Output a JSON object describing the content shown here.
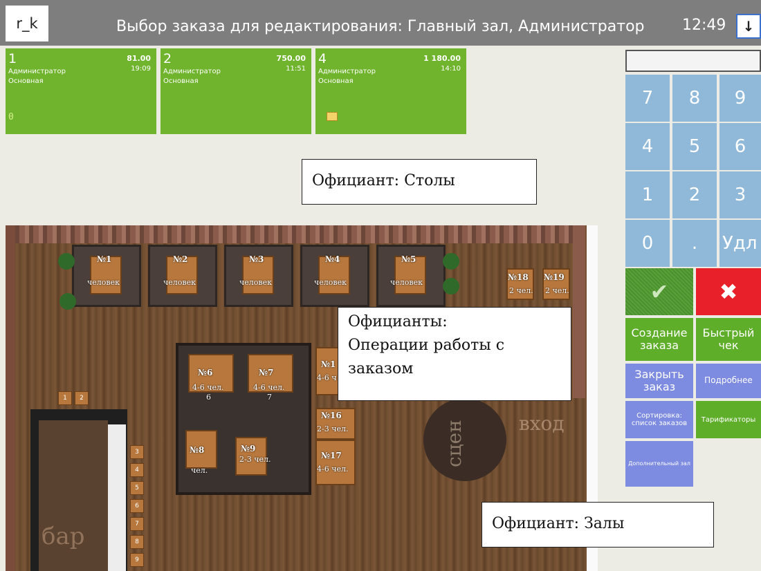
{
  "header": {
    "logo": "r_k",
    "title": "Выбор заказа для редактирования: Главный зал, Администратор",
    "time": "12:49",
    "download_glyph": "↓"
  },
  "orders": [
    {
      "number": "1",
      "sum": "81.00",
      "user": "Администратор",
      "time": "19:09",
      "hall": "Основная",
      "counter": "0",
      "icon": ""
    },
    {
      "number": "2",
      "sum": "750.00",
      "user": "Администратор",
      "time": "11:51",
      "hall": "Основная",
      "counter": "",
      "icon": ""
    },
    {
      "number": "4",
      "sum": "1 180.00",
      "user": "Администратор",
      "time": "14:10",
      "hall": "Основная",
      "counter": "",
      "icon": "folder-icon"
    }
  ],
  "notes": {
    "tables": "Официант: Столы",
    "operations_line1": "Официанты:",
    "operations_line2": "Операции работы с",
    "operations_line3": "заказом",
    "halls": "Официант: Залы"
  },
  "floor": {
    "tables": [
      {
        "id": "№1",
        "cap": "человек"
      },
      {
        "id": "№2",
        "cap": "человек"
      },
      {
        "id": "№3",
        "cap": "человек"
      },
      {
        "id": "№4",
        "cap": "человек"
      },
      {
        "id": "№5",
        "cap": "человек"
      },
      {
        "id": "№18",
        "cap": "2 чел."
      },
      {
        "id": "№19",
        "cap": "2 чел."
      },
      {
        "id": "№6",
        "cap": "4-6 чел."
      },
      {
        "id": "№7",
        "cap": "4-6 чел."
      },
      {
        "id": "№1",
        "cap": "4-6 ч"
      },
      {
        "id": "№16",
        "cap": "2-3 чел."
      },
      {
        "id": "№17",
        "cap": "4-6 чел."
      },
      {
        "id": "№8",
        "cap": "чел."
      },
      {
        "id": "№9",
        "cap": "2-3 чел."
      }
    ],
    "bar_seats": [
      "1",
      "2",
      "3",
      "4",
      "5",
      "6",
      "7",
      "8",
      "9"
    ],
    "extra_numbers": [
      "6",
      "7"
    ],
    "bar_text": "бар",
    "scene_text": "сцен",
    "entry_text": "вход"
  },
  "numpad": {
    "display": "",
    "keys": [
      "7",
      "8",
      "9",
      "4",
      "5",
      "6",
      "1",
      "2",
      "3",
      "0",
      ".",
      "Удл"
    ]
  },
  "actions": {
    "ok": "✔",
    "cancel": "✖",
    "create_order": "Создание заказа",
    "quick_check": "Быстрый чек",
    "close_order": "Закрыть заказ",
    "details": "Подробнее",
    "sorting": "Сортировка: список заказов",
    "tariffs": "Тарификаторы",
    "extra_hall": "Дополнительный зал"
  },
  "colors": {
    "topbar": "#7e7e7e",
    "card_green": "#6fb42c",
    "numpad_blue": "#8fb8d9",
    "cancel_red": "#e8202a",
    "action_green": "#5fae2a",
    "action_blue": "#7d8be0"
  }
}
